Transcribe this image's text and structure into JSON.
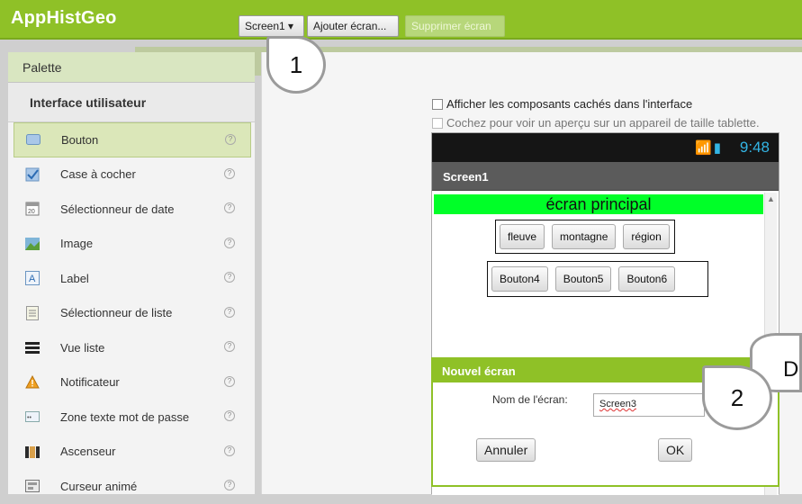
{
  "app": {
    "title": "AppHistGeo"
  },
  "toolbar": {
    "screen_dropdown": "Screen1 ▾",
    "add_screen": "Ajouter écran...",
    "remove_screen": "Supprimer écran"
  },
  "palette": {
    "header": "Palette",
    "category": "Interface utilisateur",
    "items": [
      {
        "label": "Bouton",
        "icon": "button-icon",
        "selected": true
      },
      {
        "label": "Case à cocher",
        "icon": "checkbox-icon"
      },
      {
        "label": "Sélectionneur de date",
        "icon": "calendar-icon"
      },
      {
        "label": "Image",
        "icon": "image-icon"
      },
      {
        "label": "Label",
        "icon": "label-icon"
      },
      {
        "label": "Sélectionneur de liste",
        "icon": "list-picker-icon"
      },
      {
        "label": "Vue liste",
        "icon": "list-view-icon"
      },
      {
        "label": "Notificateur",
        "icon": "warning-icon"
      },
      {
        "label": "Zone texte mot de passe",
        "icon": "password-icon"
      },
      {
        "label": "Ascenseur",
        "icon": "slider-icon"
      },
      {
        "label": "Curseur animé",
        "icon": "spinner-icon"
      }
    ]
  },
  "viewer": {
    "show_hidden": "Afficher les composants cachés dans l'interface",
    "tablet_preview": "Cochez pour voir un aperçu sur un appareil de taille tablette."
  },
  "phone": {
    "status_icons": "📶▮",
    "time": "9:48",
    "screen_title": "Screen1",
    "main_label": "écran principal",
    "row1": [
      "fleuve",
      "montagne",
      "région"
    ],
    "row2": [
      "Bouton4",
      "Bouton5",
      "Bouton6"
    ]
  },
  "dialog": {
    "title": "Nouvel écran",
    "name_label": "Nom de l'écran:",
    "name_value": "Screen3",
    "cancel": "Annuler",
    "ok": "OK"
  },
  "callouts": {
    "one": "1",
    "two": "2",
    "d": "D"
  },
  "colors": {
    "brand_green": "#8fc127",
    "label_green": "#00ff28",
    "status_blue": "#33b5e5"
  }
}
